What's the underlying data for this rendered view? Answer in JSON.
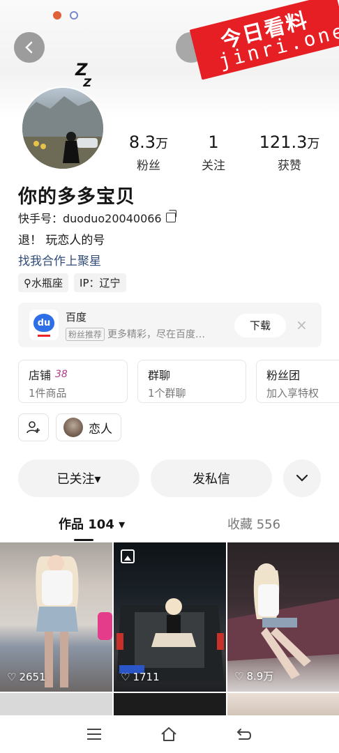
{
  "watermark": {
    "line1": "今日看料",
    "line2": "jinri.one"
  },
  "profile": {
    "name": "你的多多宝贝",
    "kuaishou_id": "快手号：duoduo20040066",
    "bio": "退！ 玩恋人的号",
    "bio_link": "找我合作上聚星",
    "tags": [
      "水瓶座",
      "IP：辽宁"
    ],
    "avatar_deco": "Z"
  },
  "stats": [
    {
      "num": "8.3",
      "unit": "万",
      "label": "粉丝"
    },
    {
      "num": "1",
      "unit": "",
      "label": "关注"
    },
    {
      "num": "121.3",
      "unit": "万",
      "label": "获赞"
    }
  ],
  "ad": {
    "title": "百度",
    "badge": "粉丝推荐",
    "subtitle": "更多精彩，尽在百度…",
    "logo_text": "du",
    "button": "下载",
    "close": "×"
  },
  "cards": [
    {
      "title": "店铺",
      "badge": "38",
      "sub": "1件商品"
    },
    {
      "title": "群聊",
      "badge": "",
      "sub": "1个群聊"
    },
    {
      "title": "粉丝团",
      "badge": "",
      "sub": "加入享特权"
    }
  ],
  "lover": {
    "label": "恋人"
  },
  "actions": {
    "follow": "已关注▾",
    "message": "发私信",
    "more": "⌄"
  },
  "tabs": {
    "works": "作品 104 ▾",
    "collect": "收藏 556"
  },
  "grid": [
    {
      "likes": "2651"
    },
    {
      "likes": "1711"
    },
    {
      "likes": "8.9万"
    }
  ],
  "colors": {
    "accent_red": "#e51f24",
    "link_blue": "#324c7a",
    "badge_purple": "#b03a8a"
  }
}
